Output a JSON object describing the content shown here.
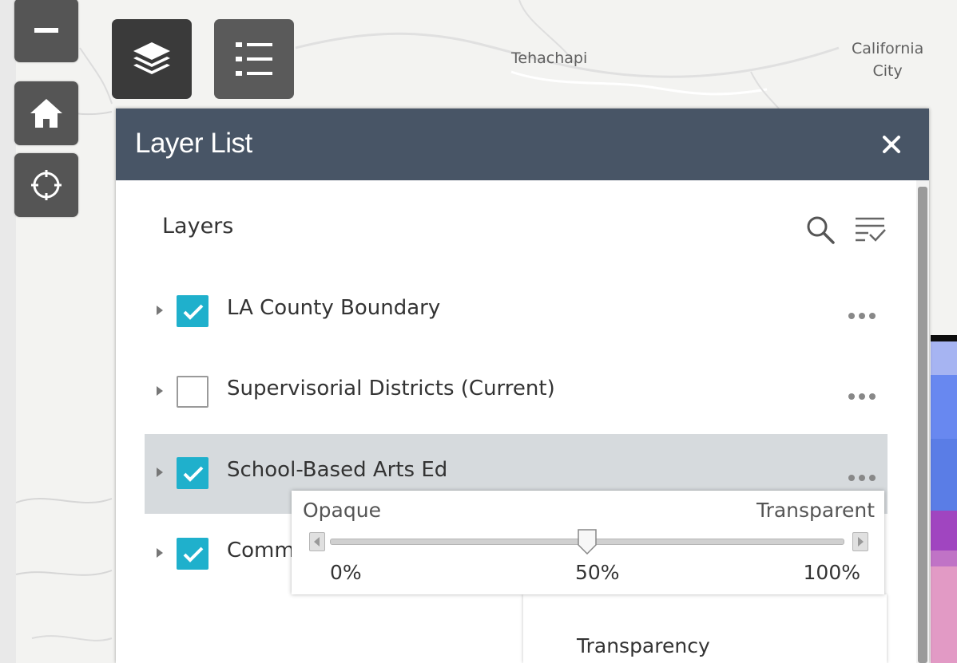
{
  "map": {
    "places": [
      {
        "name": "Tehachapi"
      },
      {
        "name": "California\nCity"
      }
    ]
  },
  "nav": {
    "zoom_out": "zoom-out",
    "home": "home",
    "locate": "locate"
  },
  "widgets": {
    "layers_icon": "layers-icon",
    "legend_icon": "legend-list-icon"
  },
  "panel": {
    "title": "Layer List",
    "close_icon": "close-icon",
    "layers_heading": "Layers",
    "search_icon": "search-icon",
    "filter_icon": "filter-icon",
    "layers": [
      {
        "label": "LA County Boundary",
        "checked": true,
        "selected": false
      },
      {
        "label": "Supervisorial Districts (Current)",
        "checked": false,
        "selected": false
      },
      {
        "label": "School-Based Arts Ed",
        "checked": true,
        "selected": true
      },
      {
        "label": "Comm",
        "checked": true,
        "selected": false
      }
    ]
  },
  "opacity_slider": {
    "left_label": "Opaque",
    "right_label": "Transparent",
    "min_label": "0%",
    "mid_label": "50%",
    "max_label": "100%",
    "value_percent": 50
  },
  "submenu": {
    "transparency": "Transparency"
  },
  "colors": {
    "header": "#485566",
    "check": "#1fb0cc",
    "strip": [
      "#0d0d0d",
      "#a6b4f2",
      "#6888f0",
      "#5a7de6",
      "#7d5fd4",
      "#a045c0",
      "#c073c6",
      "#e29ac5"
    ]
  }
}
